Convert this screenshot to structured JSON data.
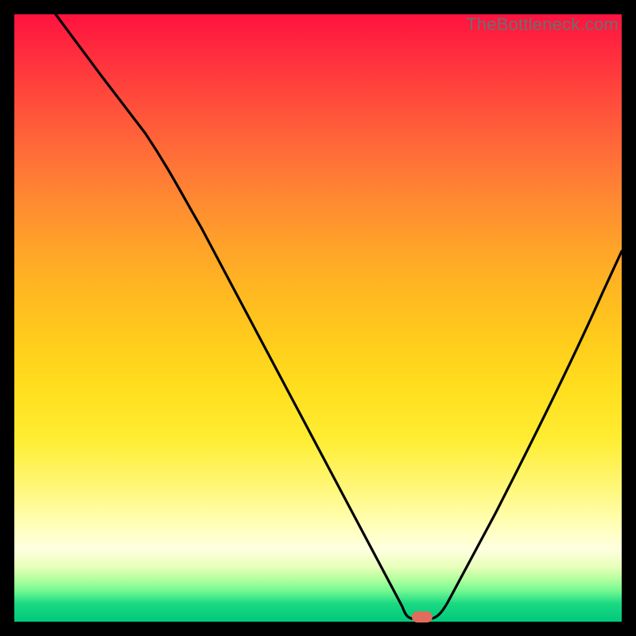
{
  "watermark": "TheBottleneck.com",
  "colors": {
    "frame_bg": "#000000",
    "curve_stroke": "#000000",
    "marker_fill": "#e16b5c",
    "watermark_color": "#6e6e6e"
  },
  "chart_data": {
    "type": "line",
    "title": "",
    "xlabel": "",
    "ylabel": "",
    "xlim": [
      0,
      100
    ],
    "ylim": [
      0,
      100
    ],
    "x": [
      0,
      5,
      10,
      15,
      20,
      25,
      30,
      35,
      40,
      45,
      50,
      55,
      60,
      62,
      64,
      66,
      70,
      75,
      80,
      85,
      90,
      95,
      100
    ],
    "values": [
      100,
      92,
      84,
      76,
      69,
      62,
      53,
      44.5,
      36,
      27.5,
      19,
      10.5,
      2,
      0,
      0,
      0.5,
      4,
      12,
      22,
      33,
      44.5,
      55.5,
      65
    ],
    "marker_x": 64,
    "marker_y": 0,
    "note": "Axis values are relative percentages inferred from plot geometry; no numeric tick labels are rendered in the source image."
  }
}
